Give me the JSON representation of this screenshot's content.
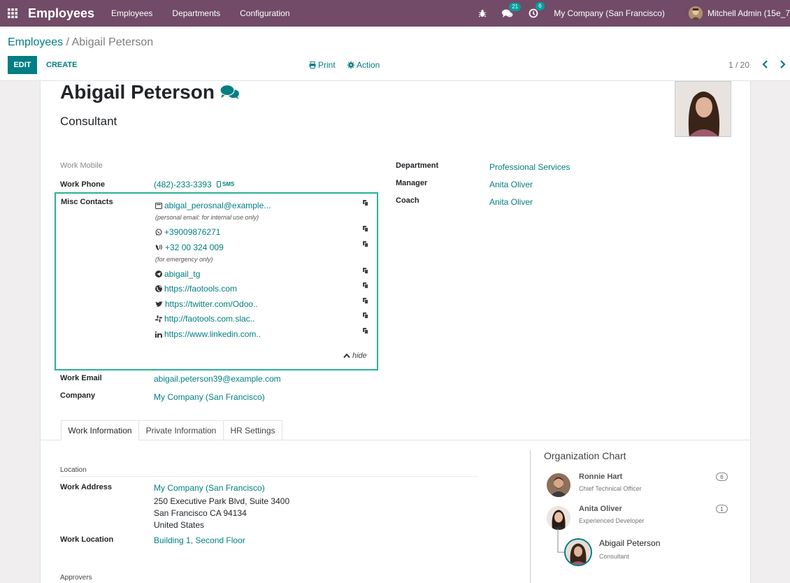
{
  "navbar": {
    "brand": "Employees",
    "menus": [
      "Employees",
      "Departments",
      "Configuration"
    ],
    "messages_count": "21",
    "activities_count": "6",
    "company": "My Company (San Francisco)",
    "user": "Mitchell Admin (15e_7"
  },
  "control": {
    "breadcrumb_parent": "Employees",
    "breadcrumb_sep": " / ",
    "breadcrumb_current": "Abigail Peterson",
    "edit_label": "EDIT",
    "create_label": "CREATE",
    "print_label": "Print",
    "action_label": "Action",
    "pager": "1 / 20"
  },
  "employee": {
    "name": "Abigail Peterson",
    "job_title": "Consultant"
  },
  "fields": {
    "work_mobile_label": "Work Mobile",
    "work_phone_label": "Work Phone",
    "work_phone": "(482)-233-3393",
    "sms_label": "SMS",
    "misc_label": "Misc Contacts",
    "work_email_label": "Work Email",
    "work_email": "abigail.peterson39@example.com",
    "company_label": "Company",
    "company": "My Company (San Francisco)",
    "department_label": "Department",
    "department": "Professional Services",
    "manager_label": "Manager",
    "manager": "Anita Oliver",
    "coach_label": "Coach",
    "coach": "Anita Oliver"
  },
  "misc_contacts": {
    "email": "abigal_perosnal@example...",
    "email_note": "(personal email: for internal use only)",
    "whatsapp": "+39009876271",
    "phone": "+32 00 324 009",
    "phone_note": "(for emergency only)",
    "telegram": "abigail_tg",
    "website": "https://faotools.com",
    "twitter": "https://twitter.com/Odoo..",
    "slack": "http://faotools.com.slac..",
    "linkedin": "https://www.linkedin.com..",
    "hide_label": "hide"
  },
  "tabs": [
    "Work Information",
    "Private Information",
    "HR Settings"
  ],
  "work_info": {
    "location_section": "Location",
    "work_address_label": "Work Address",
    "address_company": "My Company (San Francisco)",
    "address_line1": "250 Executive Park Blvd, Suite 3400",
    "address_line2": "San Francisco CA 94134",
    "address_line3": "United States",
    "work_location_label": "Work Location",
    "work_location": "Building 1, Second Floor",
    "approvers_section": "Approvers"
  },
  "org_chart": {
    "title": "Organization Chart",
    "nodes": [
      {
        "name": "Ronnie Hart",
        "title": "Chief Technical Officer",
        "count": "6"
      },
      {
        "name": "Anita Oliver",
        "title": "Experienced Developer",
        "count": "1"
      },
      {
        "name": "Abigail Peterson",
        "title": "Consultant"
      }
    ]
  },
  "colors": {
    "navbar": "#714b67",
    "accent": "#017e84",
    "highlight_border": "#28b393",
    "badge": "#00a09d"
  }
}
